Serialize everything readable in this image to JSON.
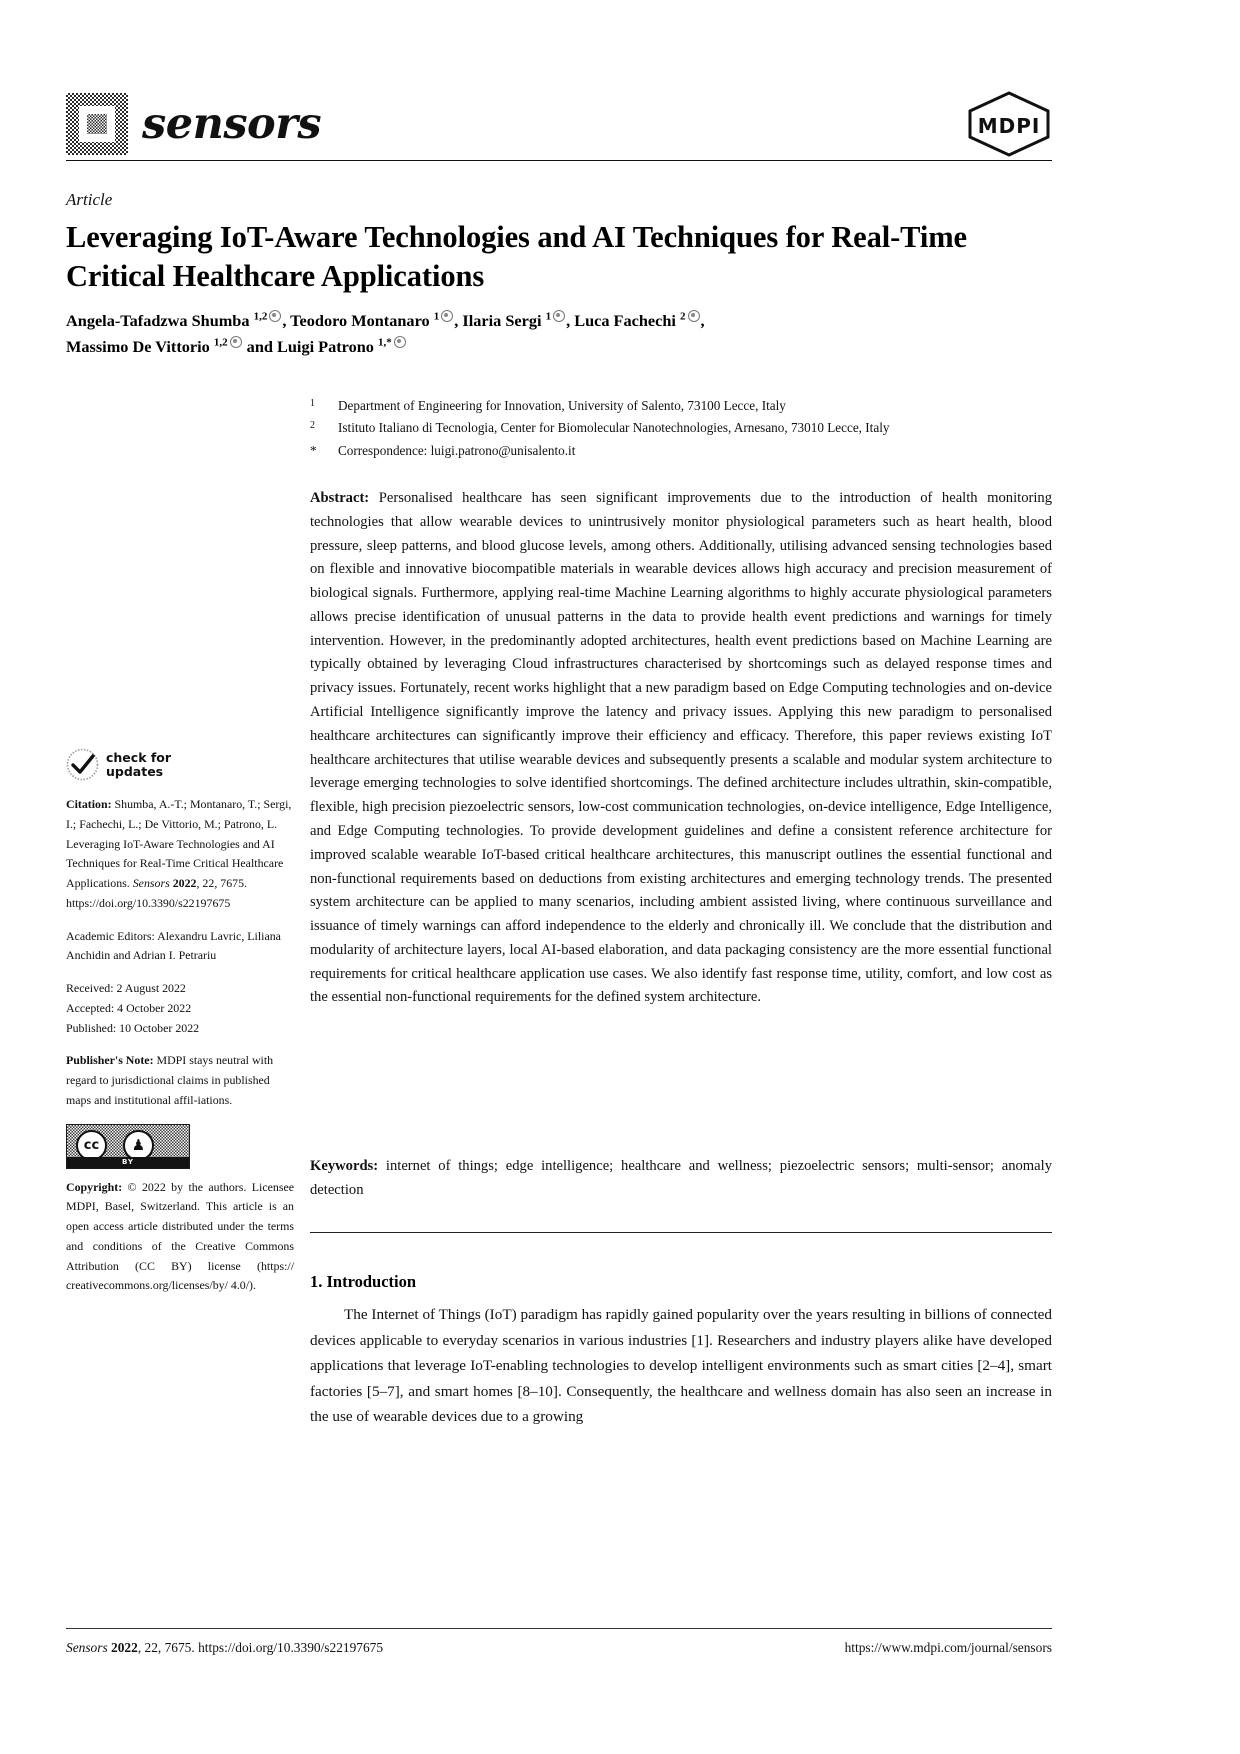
{
  "masthead": {
    "journal_name": "sensors",
    "publisher_logo_text": "MDPI",
    "logo_icon": "sensors-chip-logo-icon",
    "publisher_icon": "mdpi-hexagon-icon"
  },
  "article": {
    "type": "Article",
    "title": "Leveraging IoT-Aware Technologies and AI Techniques for Real-Time Critical Healthcare Applications",
    "authors_line_1_html": "Angela-Tafadzwa Shumba <sup>1,2</sup>@, Teodoro Montanaro <sup>1</sup>@, Ilaria Sergi <sup>1</sup>@, Luca Fachechi <sup>2</sup>@,",
    "authors_line_2_html": "Massimo De Vittorio <sup>1,2</sup>@ and Luigi Patrono <sup>1,*</sup>@"
  },
  "affiliations": [
    {
      "mark": "1",
      "text": "Department of Engineering for Innovation, University of Salento, 73100 Lecce, Italy"
    },
    {
      "mark": "2",
      "text": "Istituto Italiano di Tecnologia, Center for Biomolecular Nanotechnologies, Arnesano, 73010 Lecce, Italy"
    },
    {
      "mark": "*",
      "text": "Correspondence: luigi.patrono@unisalento.it"
    }
  ],
  "abstract": {
    "label": "Abstract:",
    "text": " Personalised healthcare has seen significant improvements due to the introduction of health monitoring technologies that allow wearable devices to unintrusively monitor physiological parameters such as heart health, blood pressure, sleep patterns, and blood glucose levels, among others. Additionally, utilising advanced sensing technologies based on flexible and innovative biocompatible materials in wearable devices allows high accuracy and precision measurement of biological signals. Furthermore, applying real-time Machine Learning algorithms to highly accurate physiological parameters allows precise identification of unusual patterns in the data to provide health event predictions and warnings for timely intervention. However, in the predominantly adopted architectures, health event predictions based on Machine Learning are typically obtained by leveraging Cloud infrastructures characterised by shortcomings such as delayed response times and privacy issues. Fortunately, recent works highlight that a new paradigm based on Edge Computing technologies and on-device Artificial Intelligence significantly improve the latency and privacy issues. Applying this new paradigm to personalised healthcare architectures can significantly improve their efficiency and efficacy. Therefore, this paper reviews existing IoT healthcare architectures that utilise wearable devices and subsequently presents a scalable and modular system architecture to leverage emerging technologies to solve identified shortcomings. The defined architecture includes ultrathin, skin-compatible, flexible, high precision piezoelectric sensors, low-cost communication technologies, on-device intelligence, Edge Intelligence, and Edge Computing technologies. To provide development guidelines and define a consistent reference architecture for improved scalable wearable IoT-based critical healthcare architectures, this manuscript outlines the essential functional and non-functional requirements based on deductions from existing architectures and emerging technology trends. The presented system architecture can be applied to many scenarios, including ambient assisted living, where continuous surveillance and issuance of timely warnings can afford independence to the elderly and chronically ill. We conclude that the distribution and modularity of architecture layers, local AI-based elaboration, and data packaging consistency are the more essential functional requirements for critical healthcare application use cases. We also identify fast response time, utility, comfort, and low cost as the essential non-functional requirements for the defined system architecture."
  },
  "keywords": {
    "label": "Keywords:",
    "text": " internet of things; edge intelligence; healthcare and wellness; piezoelectric sensors; multi-sensor; anomaly detection"
  },
  "section": {
    "heading": "1. Introduction",
    "paragraph": "The Internet of Things (IoT) paradigm has rapidly gained popularity over the years resulting in billions of connected devices applicable to everyday scenarios in various industries [1]. Researchers and industry players alike have developed applications that leverage IoT-enabling technologies to develop intelligent environments such as smart cities [2–4], smart factories [5–7], and smart homes [8–10]. Consequently, the healthcare and wellness domain has also seen an increase in the use of wearable devices due to a growing"
  },
  "sidebar": {
    "check_updates_line1": "check for",
    "check_updates_line2": "updates",
    "check_updates_icon": "check-for-updates-icon",
    "citation_label": "Citation:",
    "citation_text": " Shumba, A.-T.; Montanaro, T.; Sergi, I.; Fachechi, L.; De Vittorio, M.; Patrono, L. Leveraging IoT-Aware Technologies and AI Techniques for Real-Time Critical Healthcare Applications. ",
    "citation_journal": "Sensors",
    "citation_year_bold": "2022",
    "citation_volume_page": ", 22, 7675.",
    "citation_doi": "https://doi.org/10.3390/s22197675",
    "editors_label": "Academic Editors:",
    "editors_text": " Alexandru Lavric, Liliana Anchidin and Adrian I. Petrariu",
    "received": "Received: 2 August 2022",
    "accepted": "Accepted: 4 October 2022",
    "published": "Published: 10 October 2022",
    "publisher_note_label": "Publisher's Note:",
    "publisher_note_text": " MDPI stays neutral with regard to jurisdictional claims in published maps and institutional affil-iations.",
    "cc_icon": "creative-commons-by-icon",
    "cc_mark_1": "cc",
    "cc_mark_2": "ⓘ",
    "cc_bar_text": "BY",
    "copyright_label": "Copyright:",
    "copyright_text": " © 2022 by the authors. Licensee MDPI, Basel, Switzerland. This article is an open access article distributed under the terms and conditions of the Creative Commons Attribution (CC BY) license (https:// creativecommons.org/licenses/by/ 4.0/)."
  },
  "footer": {
    "journal": "Sensors",
    "year_bold": "2022",
    "citation_rest": ", 22, 7675. https://doi.org/10.3390/s22197675",
    "url": "https://www.mdpi.com/journal/sensors"
  }
}
